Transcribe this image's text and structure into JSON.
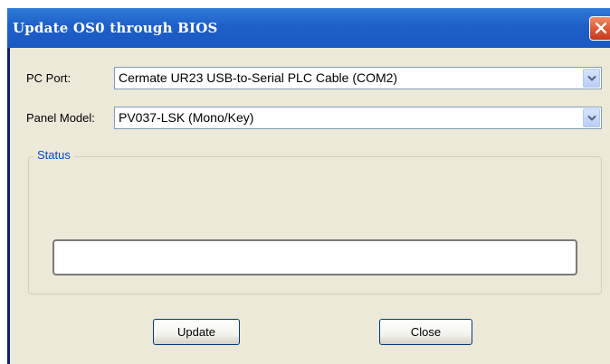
{
  "window": {
    "title": "Update OS0 through BIOS"
  },
  "form": {
    "pc_port_label": "PC Port:",
    "pc_port_value": "Cermate UR23 USB-to-Serial PLC Cable (COM2)",
    "panel_model_label": "Panel Model:",
    "panel_model_value": "PV037-LSK (Mono/Key)"
  },
  "status": {
    "group_title": "Status",
    "value": ""
  },
  "buttons": {
    "update_label": "Update",
    "close_label": "Close"
  },
  "icons": {
    "close": "close-icon",
    "dropdown": "chevron-down-icon"
  },
  "colors": {
    "titlebar": "#1e5fc8",
    "dialog_bg": "#ece9d8",
    "group_title": "#0046d5",
    "close_button": "#e05a38"
  }
}
